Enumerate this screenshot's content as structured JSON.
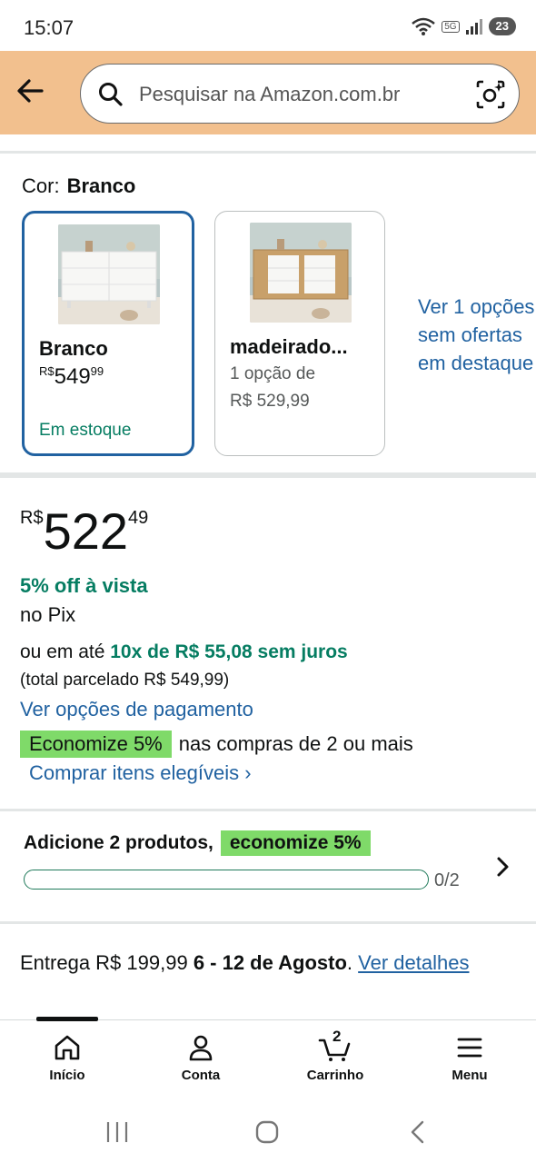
{
  "status_bar": {
    "time": "15:07",
    "network": "5G",
    "battery": "23"
  },
  "search": {
    "placeholder": "Pesquisar na Amazon.com.br"
  },
  "color": {
    "label": "Cor:",
    "selected_value": "Branco",
    "swatches": [
      {
        "name": "Branco",
        "price_symbol": "R$",
        "price_whole": "549",
        "price_fraction": "99",
        "availability": "Em estoque"
      },
      {
        "name": "madeirado...",
        "line1": "1 opção de",
        "line2": "R$ 529,99"
      }
    ],
    "more_options_lines": [
      "Ver 1 opções",
      "sem ofertas",
      "em destaque"
    ]
  },
  "price": {
    "symbol": "R$",
    "whole": "522",
    "fraction": "49"
  },
  "pix": {
    "discount": "5% off à vista",
    "label": "no Pix"
  },
  "installments": {
    "prefix": "ou em até ",
    "highlight": "10x de R$ 55,08 sem juros",
    "total": "(total parcelado R$ 549,99)",
    "payment_link": "Ver opções de pagamento"
  },
  "promotion": {
    "badge": "Economize 5%",
    "text": "nas compras de 2 ou mais",
    "link": "Comprar itens elegíveis ›"
  },
  "bundle": {
    "title": "Adicione 2 produtos,",
    "badge": "economize 5%",
    "progress_text": "0/2",
    "progress_fraction": 0
  },
  "delivery": {
    "prefix": "Entrega R$ 199,99 ",
    "dates": "6 - 12 de Agosto",
    "suffix": ". ",
    "link": "Ver detalhes"
  },
  "bottom_nav": {
    "items": [
      {
        "label": "Início",
        "icon": "home-icon"
      },
      {
        "label": "Conta",
        "icon": "account-icon"
      },
      {
        "label": "Carrinho",
        "icon": "cart-icon",
        "badge": "2"
      },
      {
        "label": "Menu",
        "icon": "menu-icon"
      }
    ]
  },
  "colors": {
    "header": "#F2C08E",
    "link": "#2162A1",
    "green": "#067D62",
    "badge_green": "#7FDA69",
    "selected_border": "#2162A1"
  }
}
